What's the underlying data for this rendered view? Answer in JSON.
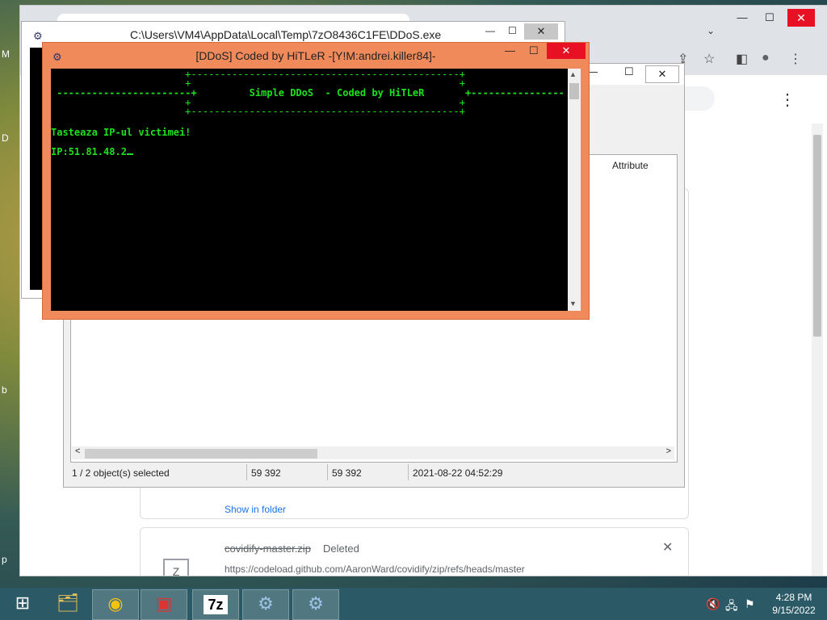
{
  "desktop": {
    "edge_labels": [
      "M",
      "D",
      "b",
      "p"
    ]
  },
  "chrome": {
    "window_controls": {
      "minimize": "—",
      "maximize": "☐",
      "close": "✕"
    },
    "tab_menu_glyph": "⌄",
    "toolbar_icons": [
      "share-icon",
      "star-icon",
      "sidebar-icon",
      "profile-icon",
      "menu-icon"
    ],
    "toolbar_glyphs": {
      "share": "⇪",
      "star": "☆",
      "sidebar": "◧",
      "profile": "●",
      "menu": "⋮"
    },
    "downloads": {
      "items": [
        {
          "show_in_folder": "Show in folder"
        },
        {
          "file_name": "covidify-master.zip",
          "status": "Deleted",
          "url": "https://codeload.github.com/AaronWard/covidify/zip/refs/heads/master",
          "remove_glyph": "✕",
          "file_icon_glyph": "Z"
        }
      ]
    }
  },
  "file_manager": {
    "column_header": "Attribute",
    "status": {
      "selection": "1 / 2 object(s) selected",
      "size": "59 392",
      "packed": "59 392",
      "modified": "2021-08-22 04:52:29"
    },
    "scroll_left": "<",
    "scroll_right": ">",
    "dropdown_glyph": "⌄",
    "close_glyph": "✕"
  },
  "exe_window": {
    "title": "C:\\Users\\VM4\\AppData\\Local\\Temp\\7zO8436C1FE\\DDoS.exe"
  },
  "ddos_window": {
    "title": "[DDoS] Coded by HiTLeR -[Y!M:andrei.killer84]-",
    "banner": {
      "top_border": "                       +----------------------------------------------+",
      "line1": "                       +                                              +",
      "line2": " -----------------------+         Simple DDoS  - Coded by HiTLeR       +----------------",
      "line3": "                       +                                              +",
      "bottom_border": "                       +----------------------------------------------+"
    },
    "prompt": "Tasteaza IP-ul victimei!",
    "input_label": "IP:",
    "input_value": "51.81.48.2"
  },
  "taskbar": {
    "apps": [
      {
        "name": "Start",
        "glyph": "⊞"
      },
      {
        "name": "File Explorer",
        "glyph": "🗂"
      },
      {
        "name": "Google Chrome",
        "glyph": "◉"
      },
      {
        "name": "Installer",
        "glyph": "▣"
      },
      {
        "name": "7-Zip",
        "glyph": "7z"
      },
      {
        "name": "DDoS.exe",
        "glyph": "⚙"
      },
      {
        "name": "DDoS console",
        "glyph": "⚙"
      }
    ],
    "tray": {
      "volume": "🔇",
      "network": "🖧",
      "flag": "⚑"
    },
    "clock": {
      "time": "4:28 PM",
      "date": "9/15/2022"
    }
  }
}
